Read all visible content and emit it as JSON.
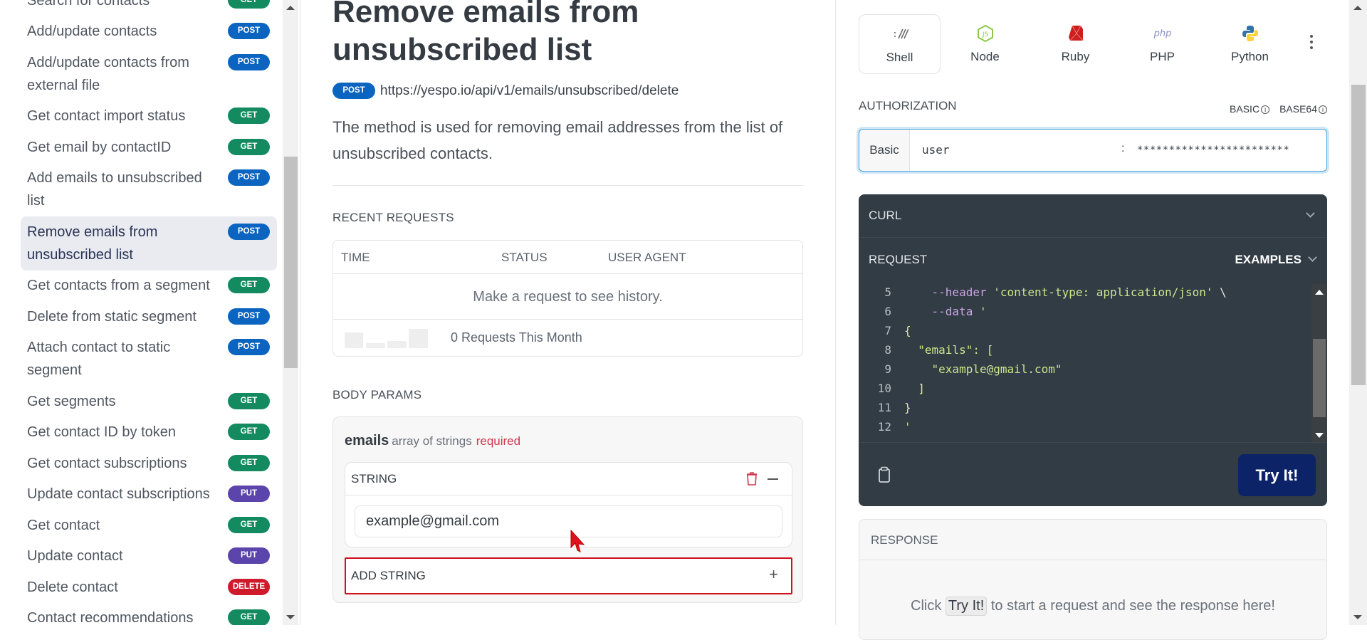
{
  "colors": {
    "GET": "#138a5f",
    "POST": "#0b64bf",
    "PUT": "#5b44ab",
    "DELETE": "#cf1a2c",
    "accent": "#0c2367",
    "highlight": "#d0101b"
  },
  "sidebar": {
    "items": [
      {
        "label": "Search for contacts",
        "method": "GET"
      },
      {
        "label": "Add/update contacts",
        "method": "POST"
      },
      {
        "label": "Add/update contacts from external file",
        "method": "POST"
      },
      {
        "label": "Get contact import status",
        "method": "GET"
      },
      {
        "label": "Get email by contactID",
        "method": "GET"
      },
      {
        "label": "Add emails to unsubscribed list",
        "method": "POST"
      },
      {
        "label": "Remove emails from unsubscribed list",
        "method": "POST",
        "active": true
      },
      {
        "label": "Get contacts from a segment",
        "method": "GET"
      },
      {
        "label": "Delete from static segment",
        "method": "POST"
      },
      {
        "label": "Attach contact to static segment",
        "method": "POST"
      },
      {
        "label": "Get segments",
        "method": "GET"
      },
      {
        "label": "Get contact ID by token",
        "method": "GET"
      },
      {
        "label": "Get contact subscriptions",
        "method": "GET"
      },
      {
        "label": "Update contact subscriptions",
        "method": "PUT"
      },
      {
        "label": "Get contact",
        "method": "GET"
      },
      {
        "label": "Update contact",
        "method": "PUT"
      },
      {
        "label": "Delete contact",
        "method": "DELETE"
      },
      {
        "label": "Contact recommendations",
        "method": "GET"
      }
    ]
  },
  "main": {
    "title": "Remove emails from unsubscribed list",
    "method": "POST",
    "url": "https://yespo.io/api/v1/emails/unsubscribed/delete",
    "description": "The method is used for removing email addresses from the list of unsubscribed contacts.",
    "recent_requests": {
      "heading": "RECENT REQUESTS",
      "columns": [
        "TIME",
        "STATUS",
        "USER AGENT"
      ],
      "empty": "Make a request to see history.",
      "count": "0 Requests This Month"
    },
    "body_params": {
      "heading": "BODY PARAMS",
      "name": "emails",
      "type": "array of strings",
      "required": "required",
      "item_label": "STRING",
      "value": "example@gmail.com",
      "add_label": "ADD STRING"
    }
  },
  "right": {
    "languages": [
      {
        "label": "Shell",
        "icon": "shell-icon",
        "active": true
      },
      {
        "label": "Node",
        "icon": "nodejs-icon"
      },
      {
        "label": "Ruby",
        "icon": "ruby-icon"
      },
      {
        "label": "PHP",
        "icon": "php-icon"
      },
      {
        "label": "Python",
        "icon": "python-icon"
      }
    ],
    "auth": {
      "label": "AUTHORIZATION",
      "options": [
        "BASIC",
        "BASE64"
      ],
      "scheme": "Basic",
      "user": "user",
      "separator": ":",
      "password": "************************"
    },
    "curl_label": "CURL",
    "request_label": "REQUEST",
    "examples_label": "EXAMPLES",
    "code": [
      {
        "n": "5",
        "tokens": [
          {
            "t": "    --header ",
            "c": "flag"
          },
          {
            "t": "'content-type: application/json'",
            "c": "str"
          },
          {
            "t": " \\",
            "c": "plain"
          }
        ]
      },
      {
        "n": "6",
        "tokens": [
          {
            "t": "    --data ",
            "c": "flag"
          },
          {
            "t": "'",
            "c": "str"
          }
        ]
      },
      {
        "n": "7",
        "tokens": [
          {
            "t": "{",
            "c": "pun"
          }
        ]
      },
      {
        "n": "8",
        "tokens": [
          {
            "t": "  \"emails\": [",
            "c": "str"
          }
        ]
      },
      {
        "n": "9",
        "tokens": [
          {
            "t": "    \"example@gmail.com\"",
            "c": "str"
          }
        ]
      },
      {
        "n": "10",
        "tokens": [
          {
            "t": "  ]",
            "c": "pun"
          }
        ]
      },
      {
        "n": "11",
        "tokens": [
          {
            "t": "}",
            "c": "pun"
          }
        ]
      },
      {
        "n": "12",
        "tokens": [
          {
            "t": "'",
            "c": "str"
          }
        ]
      }
    ],
    "try_label": "Try It!",
    "response": {
      "heading": "RESPONSE",
      "msg_pre": "Click",
      "msg_btn": "Try It!",
      "msg_post": "to start a request and see the response here!"
    }
  }
}
